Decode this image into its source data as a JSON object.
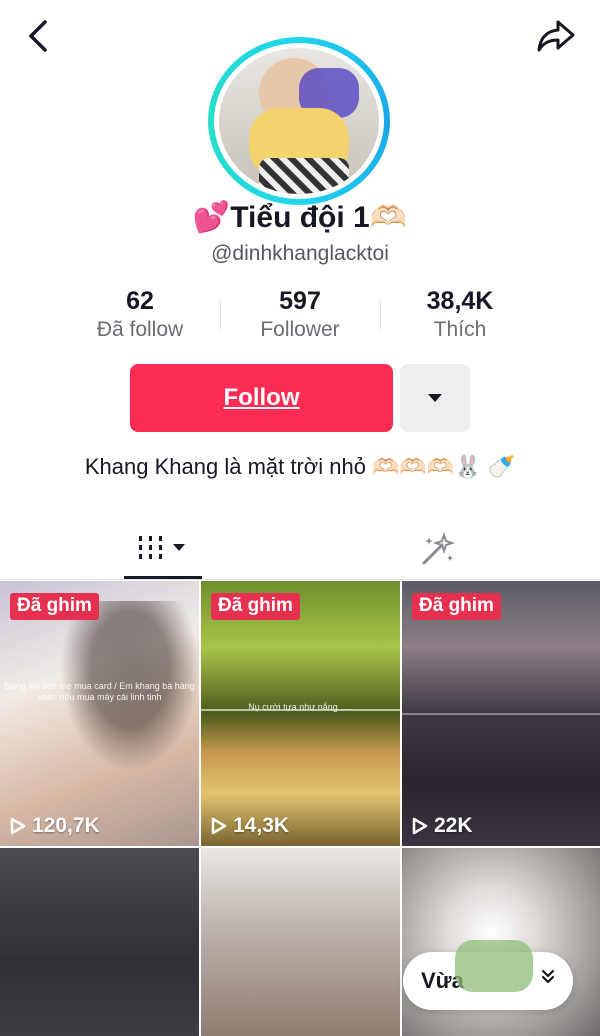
{
  "header": {
    "back_icon": "chevron-left-icon",
    "share_icon": "share-arrow-icon"
  },
  "profile": {
    "display_name": "💕Tiểu đội 1🫶🏻",
    "username": "@dinhkhanglacktoi",
    "bio": "Khang Khang là mặt trời nhỏ 🫶🏻🫶🏻🫶🏻🐰 🍼"
  },
  "stats": [
    {
      "value": "62",
      "label": "Đã follow"
    },
    {
      "value": "597",
      "label": "Follower"
    },
    {
      "value": "38,4K",
      "label": "Thích"
    }
  ],
  "actions": {
    "follow_label": "Follow",
    "more_icon": "caret-down-icon"
  },
  "tabs": {
    "videos_icon": "grid-bars-icon",
    "liked_icon": "sparkle-wand-icon"
  },
  "videos": [
    {
      "pinned_label": "Đã ghim",
      "views": "120,7K",
      "caption": "Đang xin tiền mẹ mua card / Em khang bà hàng xóm: nếu mua máy cái linh tinh"
    },
    {
      "pinned_label": "Đã ghim",
      "views": "14,3K",
      "caption": "Nụ cười tựa như nắng ....."
    },
    {
      "pinned_label": "Đã ghim",
      "views": "22K"
    },
    {},
    {},
    {}
  ],
  "floating": {
    "now_label": "Vừa",
    "chevron_icon": "double-chevron-down-icon"
  },
  "colors": {
    "follow_red": "#fe2c55",
    "pinned_red": "#e5304f",
    "ring_teal": "#20d5ec"
  }
}
